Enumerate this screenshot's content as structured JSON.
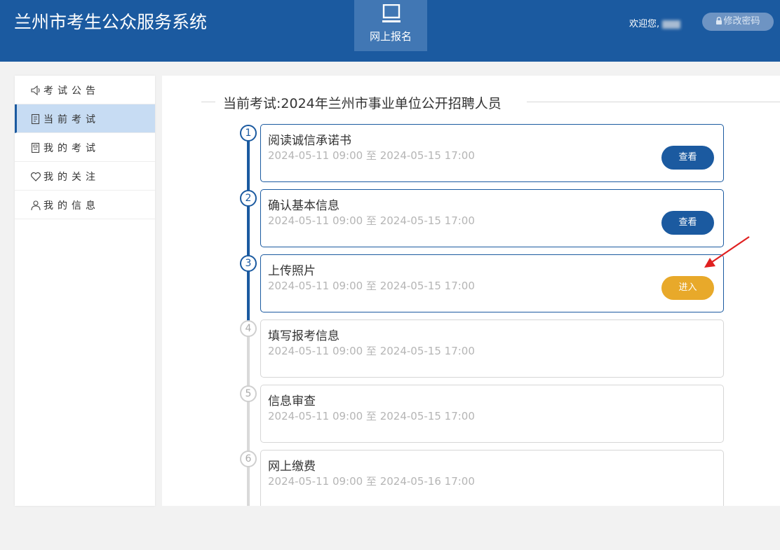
{
  "header": {
    "app_title": "兰州市考生公众服务系统",
    "nav_tile_label": "网上报名",
    "nav_tile_icon": "monitor-icon",
    "welcome_text": "欢迎您,",
    "change_password_label": "修改密码",
    "change_password_icon": "lock-icon"
  },
  "sidebar": {
    "items": [
      {
        "label": "考试公告",
        "icon": "speaker-icon",
        "active": false
      },
      {
        "label": "当前考试",
        "icon": "document-icon",
        "active": true
      },
      {
        "label": "我的考试",
        "icon": "report-icon",
        "active": false
      },
      {
        "label": "我的关注",
        "icon": "heart-icon",
        "active": false
      },
      {
        "label": "我的信息",
        "icon": "user-icon",
        "active": false
      }
    ]
  },
  "main": {
    "exam_title": "当前考试:2024年兰州市事业单位公开招聘人员",
    "steps": [
      {
        "num": "1",
        "name": "阅读诚信承诺书",
        "time": "2024-05-11 09:00 至 2024-05-15 17:00",
        "button": "查看",
        "status": "done"
      },
      {
        "num": "2",
        "name": "确认基本信息",
        "time": "2024-05-11 09:00 至 2024-05-15 17:00",
        "button": "查看",
        "status": "done"
      },
      {
        "num": "3",
        "name": "上传照片",
        "time": "2024-05-11 09:00 至 2024-05-15 17:00",
        "button": "进入",
        "status": "current"
      },
      {
        "num": "4",
        "name": "填写报考信息",
        "time": "2024-05-11 09:00 至 2024-05-15 17:00",
        "button": "",
        "status": "todo"
      },
      {
        "num": "5",
        "name": "信息审查",
        "time": "2024-05-11 09:00 至 2024-05-15 17:00",
        "button": "",
        "status": "todo"
      },
      {
        "num": "6",
        "name": "网上缴费",
        "time": "2024-05-11 09:00 至 2024-05-16 17:00",
        "button": "",
        "status": "todo"
      }
    ]
  },
  "colors": {
    "header_bg": "#1b5aa0",
    "accent": "#1b5aa0",
    "enter_button": "#e8a92a",
    "annotation_arrow": "#e02020"
  }
}
